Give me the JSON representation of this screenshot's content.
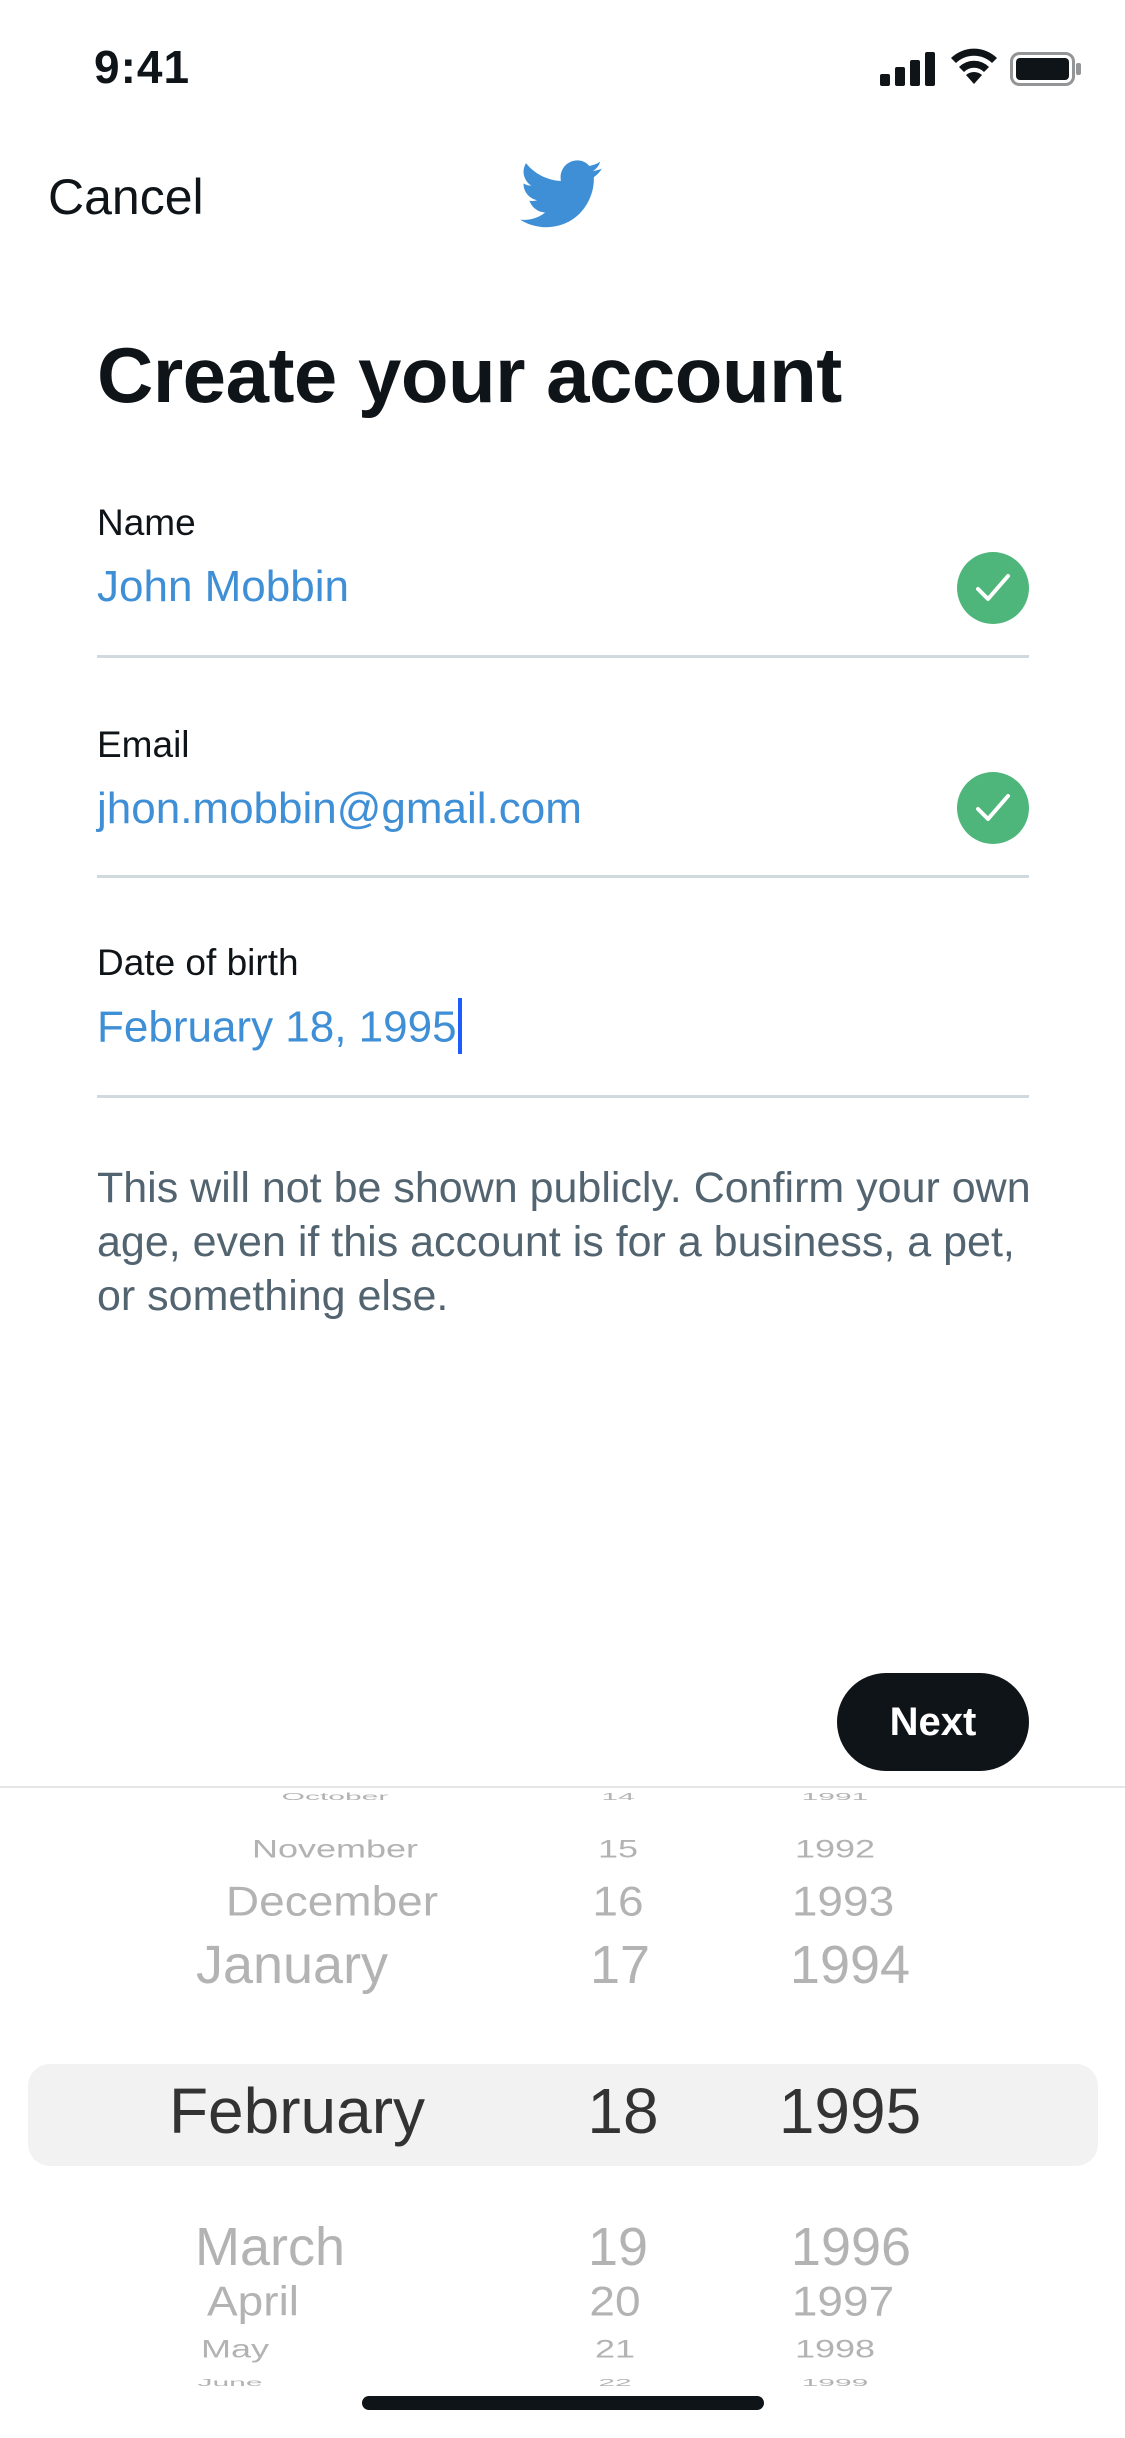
{
  "status_bar": {
    "time": "9:41"
  },
  "nav": {
    "cancel_label": "Cancel",
    "logo_icon": "twitter-bird-icon",
    "brand_color": "#1DA1F2"
  },
  "page": {
    "title": "Create your account"
  },
  "form": {
    "name": {
      "label": "Name",
      "value": "John Mobbin",
      "valid": true
    },
    "email": {
      "label": "Email",
      "value": "jhon.mobbin@gmail.com",
      "valid": true
    },
    "dob": {
      "label": "Date of birth",
      "value": "February 18, 1995"
    },
    "helper_text": "This will not be shown publicly. Confirm your own age, even if this account is for a business, a pet, or something else."
  },
  "actions": {
    "next_label": "Next"
  },
  "colors": {
    "accent": "#3F8FD6",
    "check": "#4FB67B",
    "button": "#0F1419",
    "helper": "#536471"
  },
  "date_picker": {
    "months": [
      "October",
      "November",
      "December",
      "January",
      "February",
      "March",
      "April",
      "May",
      "June"
    ],
    "days": [
      "14",
      "15",
      "16",
      "17",
      "18",
      "19",
      "20",
      "21",
      "22"
    ],
    "years": [
      "1991",
      "1992",
      "1993",
      "1994",
      "1995",
      "1996",
      "1997",
      "1998",
      "1999"
    ],
    "selected": {
      "month": "February",
      "day": "18",
      "year": "1995"
    }
  }
}
